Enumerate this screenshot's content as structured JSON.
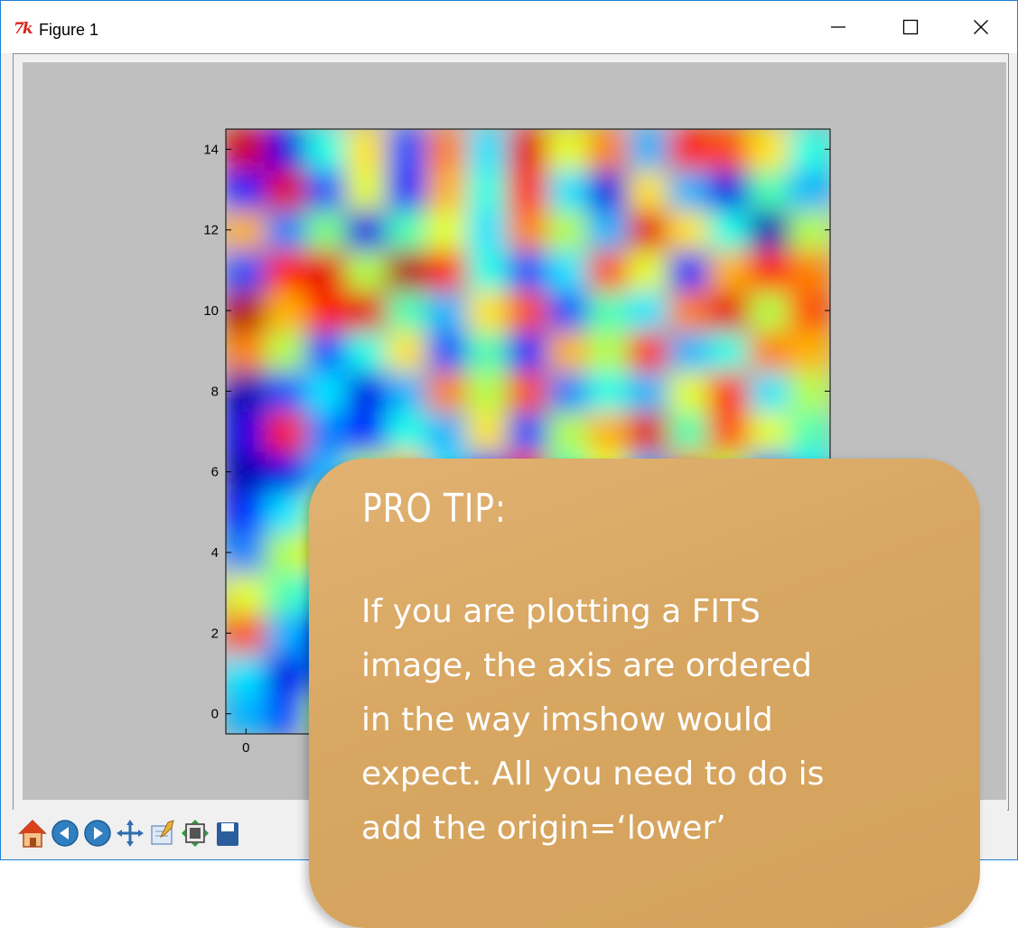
{
  "window": {
    "title": "Figure 1",
    "app_icon": "7k",
    "controls": [
      {
        "name": "minimize-icon",
        "glyph": "—"
      },
      {
        "name": "maximize-icon",
        "glyph": "□"
      },
      {
        "name": "close-icon",
        "glyph": "✕"
      }
    ]
  },
  "chart_data": {
    "type": "heatmap",
    "title": "",
    "xlabel": "",
    "ylabel": "",
    "colormap": "jet",
    "interpolation": "smooth",
    "ylim": [
      -0.5,
      14.5
    ],
    "y_ticks": [
      "0",
      "2",
      "4",
      "6",
      "8",
      "10",
      "12",
      "14"
    ],
    "x_ticks_visible": [
      "0"
    ],
    "grid_size": [
      15,
      15
    ],
    "values": [
      [
        0.3,
        0.2,
        0.55,
        0.75,
        0.1,
        0.4,
        0.25,
        0.8,
        0.6,
        0.35,
        0.15,
        0.7,
        0.45,
        0.2,
        0.65
      ],
      [
        0.35,
        0.1,
        0.25,
        0.65,
        0.85,
        0.3,
        0.55,
        0.2,
        0.75,
        0.45,
        0.25,
        0.6,
        0.35,
        0.8,
        0.5
      ],
      [
        0.8,
        0.3,
        0.15,
        0.4,
        0.6,
        0.2,
        0.7,
        0.45,
        0.3,
        0.85,
        0.55,
        0.25,
        0.65,
        0.4,
        0.2
      ],
      [
        0.6,
        0.45,
        0.35,
        0.2,
        0.75,
        0.55,
        0.3,
        0.85,
        0.4,
        0.15,
        0.7,
        0.5,
        0.3,
        0.6,
        0.85
      ],
      [
        0.25,
        0.55,
        0.65,
        0.3,
        0.45,
        0.8,
        0.2,
        0.6,
        0.35,
        0.7,
        0.25,
        0.85,
        0.45,
        0.2,
        0.55
      ],
      [
        0.15,
        0.35,
        0.55,
        0.7,
        0.25,
        0.4,
        0.6,
        0.3,
        0.75,
        0.5,
        0.2,
        0.65,
        0.35,
        0.8,
        0.4
      ],
      [
        0.05,
        0.1,
        0.3,
        0.55,
        0.7,
        0.35,
        0.2,
        0.8,
        0.45,
        0.6,
        0.3,
        0.75,
        0.55,
        0.25,
        0.35
      ],
      [
        0.1,
        0.85,
        0.25,
        0.15,
        0.4,
        0.3,
        0.65,
        0.2,
        0.55,
        0.7,
        0.9,
        0.45,
        0.8,
        0.6,
        0.45
      ],
      [
        0.05,
        0.2,
        0.35,
        0.1,
        0.3,
        0.75,
        0.55,
        0.8,
        0.25,
        0.4,
        0.3,
        0.6,
        0.85,
        0.35,
        0.55
      ],
      [
        0.75,
        0.55,
        0.2,
        0.4,
        0.65,
        0.2,
        0.45,
        0.15,
        0.7,
        0.55,
        0.85,
        0.3,
        0.4,
        0.75,
        0.7
      ],
      [
        0.95,
        0.7,
        0.85,
        0.9,
        0.45,
        0.3,
        0.65,
        0.8,
        0.2,
        0.45,
        0.35,
        0.75,
        0.9,
        0.55,
        0.8
      ],
      [
        0.2,
        0.85,
        0.9,
        0.55,
        0.95,
        0.85,
        0.4,
        0.2,
        0.35,
        0.8,
        0.6,
        0.15,
        0.7,
        0.85,
        0.75
      ],
      [
        0.7,
        0.25,
        0.5,
        0.1,
        0.45,
        0.6,
        0.35,
        0.75,
        0.55,
        0.3,
        0.9,
        0.65,
        0.4,
        0.05,
        0.55
      ],
      [
        0.15,
        0.9,
        0.2,
        0.6,
        0.15,
        0.7,
        0.4,
        0.85,
        0.35,
        0.1,
        0.65,
        0.3,
        0.1,
        0.45,
        0.3
      ],
      [
        0.92,
        0.1,
        0.4,
        0.65,
        0.2,
        0.75,
        0.35,
        0.9,
        0.6,
        0.75,
        0.3,
        0.85,
        0.8,
        0.65,
        0.4
      ]
    ]
  },
  "toolbar": {
    "tools": [
      {
        "name": "home-icon"
      },
      {
        "name": "back-icon"
      },
      {
        "name": "forward-icon"
      },
      {
        "name": "pan-icon"
      },
      {
        "name": "edit-subplots-icon"
      },
      {
        "name": "configure-icon"
      },
      {
        "name": "save-icon"
      }
    ]
  },
  "tip": {
    "title": "PRO TIP:",
    "body": "If you are plotting a FITS\nimage, the axis are ordered\nin the way imshow would\nexpect.  All you need to do is\nadd the origin=‘lower’"
  }
}
